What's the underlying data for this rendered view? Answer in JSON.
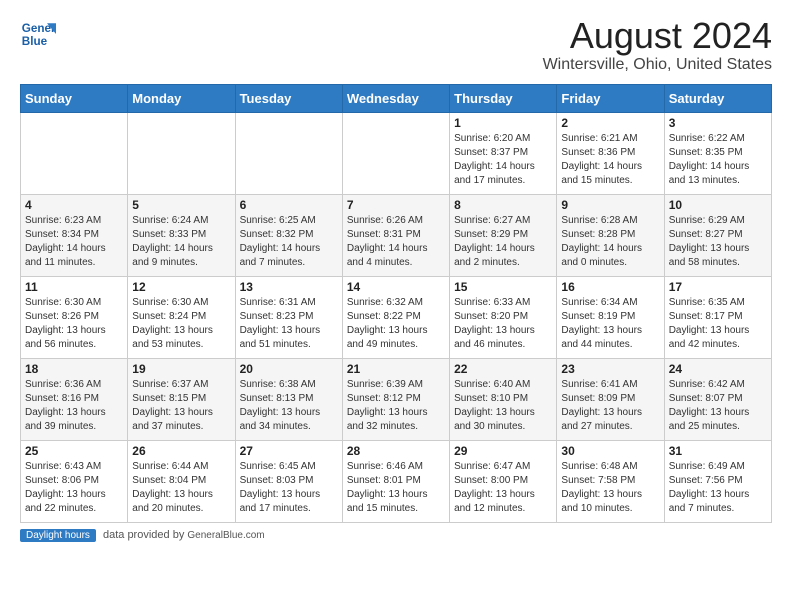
{
  "header": {
    "logo_line1": "General",
    "logo_line2": "Blue",
    "main_title": "August 2024",
    "subtitle": "Wintersville, Ohio, United States"
  },
  "weekdays": [
    "Sunday",
    "Monday",
    "Tuesday",
    "Wednesday",
    "Thursday",
    "Friday",
    "Saturday"
  ],
  "weeks": [
    [
      {
        "day": "",
        "info": ""
      },
      {
        "day": "",
        "info": ""
      },
      {
        "day": "",
        "info": ""
      },
      {
        "day": "",
        "info": ""
      },
      {
        "day": "1",
        "info": "Sunrise: 6:20 AM\nSunset: 8:37 PM\nDaylight: 14 hours\nand 17 minutes."
      },
      {
        "day": "2",
        "info": "Sunrise: 6:21 AM\nSunset: 8:36 PM\nDaylight: 14 hours\nand 15 minutes."
      },
      {
        "day": "3",
        "info": "Sunrise: 6:22 AM\nSunset: 8:35 PM\nDaylight: 14 hours\nand 13 minutes."
      }
    ],
    [
      {
        "day": "4",
        "info": "Sunrise: 6:23 AM\nSunset: 8:34 PM\nDaylight: 14 hours\nand 11 minutes."
      },
      {
        "day": "5",
        "info": "Sunrise: 6:24 AM\nSunset: 8:33 PM\nDaylight: 14 hours\nand 9 minutes."
      },
      {
        "day": "6",
        "info": "Sunrise: 6:25 AM\nSunset: 8:32 PM\nDaylight: 14 hours\nand 7 minutes."
      },
      {
        "day": "7",
        "info": "Sunrise: 6:26 AM\nSunset: 8:31 PM\nDaylight: 14 hours\nand 4 minutes."
      },
      {
        "day": "8",
        "info": "Sunrise: 6:27 AM\nSunset: 8:29 PM\nDaylight: 14 hours\nand 2 minutes."
      },
      {
        "day": "9",
        "info": "Sunrise: 6:28 AM\nSunset: 8:28 PM\nDaylight: 14 hours\nand 0 minutes."
      },
      {
        "day": "10",
        "info": "Sunrise: 6:29 AM\nSunset: 8:27 PM\nDaylight: 13 hours\nand 58 minutes."
      }
    ],
    [
      {
        "day": "11",
        "info": "Sunrise: 6:30 AM\nSunset: 8:26 PM\nDaylight: 13 hours\nand 56 minutes."
      },
      {
        "day": "12",
        "info": "Sunrise: 6:30 AM\nSunset: 8:24 PM\nDaylight: 13 hours\nand 53 minutes."
      },
      {
        "day": "13",
        "info": "Sunrise: 6:31 AM\nSunset: 8:23 PM\nDaylight: 13 hours\nand 51 minutes."
      },
      {
        "day": "14",
        "info": "Sunrise: 6:32 AM\nSunset: 8:22 PM\nDaylight: 13 hours\nand 49 minutes."
      },
      {
        "day": "15",
        "info": "Sunrise: 6:33 AM\nSunset: 8:20 PM\nDaylight: 13 hours\nand 46 minutes."
      },
      {
        "day": "16",
        "info": "Sunrise: 6:34 AM\nSunset: 8:19 PM\nDaylight: 13 hours\nand 44 minutes."
      },
      {
        "day": "17",
        "info": "Sunrise: 6:35 AM\nSunset: 8:17 PM\nDaylight: 13 hours\nand 42 minutes."
      }
    ],
    [
      {
        "day": "18",
        "info": "Sunrise: 6:36 AM\nSunset: 8:16 PM\nDaylight: 13 hours\nand 39 minutes."
      },
      {
        "day": "19",
        "info": "Sunrise: 6:37 AM\nSunset: 8:15 PM\nDaylight: 13 hours\nand 37 minutes."
      },
      {
        "day": "20",
        "info": "Sunrise: 6:38 AM\nSunset: 8:13 PM\nDaylight: 13 hours\nand 34 minutes."
      },
      {
        "day": "21",
        "info": "Sunrise: 6:39 AM\nSunset: 8:12 PM\nDaylight: 13 hours\nand 32 minutes."
      },
      {
        "day": "22",
        "info": "Sunrise: 6:40 AM\nSunset: 8:10 PM\nDaylight: 13 hours\nand 30 minutes."
      },
      {
        "day": "23",
        "info": "Sunrise: 6:41 AM\nSunset: 8:09 PM\nDaylight: 13 hours\nand 27 minutes."
      },
      {
        "day": "24",
        "info": "Sunrise: 6:42 AM\nSunset: 8:07 PM\nDaylight: 13 hours\nand 25 minutes."
      }
    ],
    [
      {
        "day": "25",
        "info": "Sunrise: 6:43 AM\nSunset: 8:06 PM\nDaylight: 13 hours\nand 22 minutes."
      },
      {
        "day": "26",
        "info": "Sunrise: 6:44 AM\nSunset: 8:04 PM\nDaylight: 13 hours\nand 20 minutes."
      },
      {
        "day": "27",
        "info": "Sunrise: 6:45 AM\nSunset: 8:03 PM\nDaylight: 13 hours\nand 17 minutes."
      },
      {
        "day": "28",
        "info": "Sunrise: 6:46 AM\nSunset: 8:01 PM\nDaylight: 13 hours\nand 15 minutes."
      },
      {
        "day": "29",
        "info": "Sunrise: 6:47 AM\nSunset: 8:00 PM\nDaylight: 13 hours\nand 12 minutes."
      },
      {
        "day": "30",
        "info": "Sunrise: 6:48 AM\nSunset: 7:58 PM\nDaylight: 13 hours\nand 10 minutes."
      },
      {
        "day": "31",
        "info": "Sunrise: 6:49 AM\nSunset: 7:56 PM\nDaylight: 13 hours\nand 7 minutes."
      }
    ]
  ],
  "footer": {
    "label": "Daylight hours",
    "source": "GeneralBlue.com"
  }
}
